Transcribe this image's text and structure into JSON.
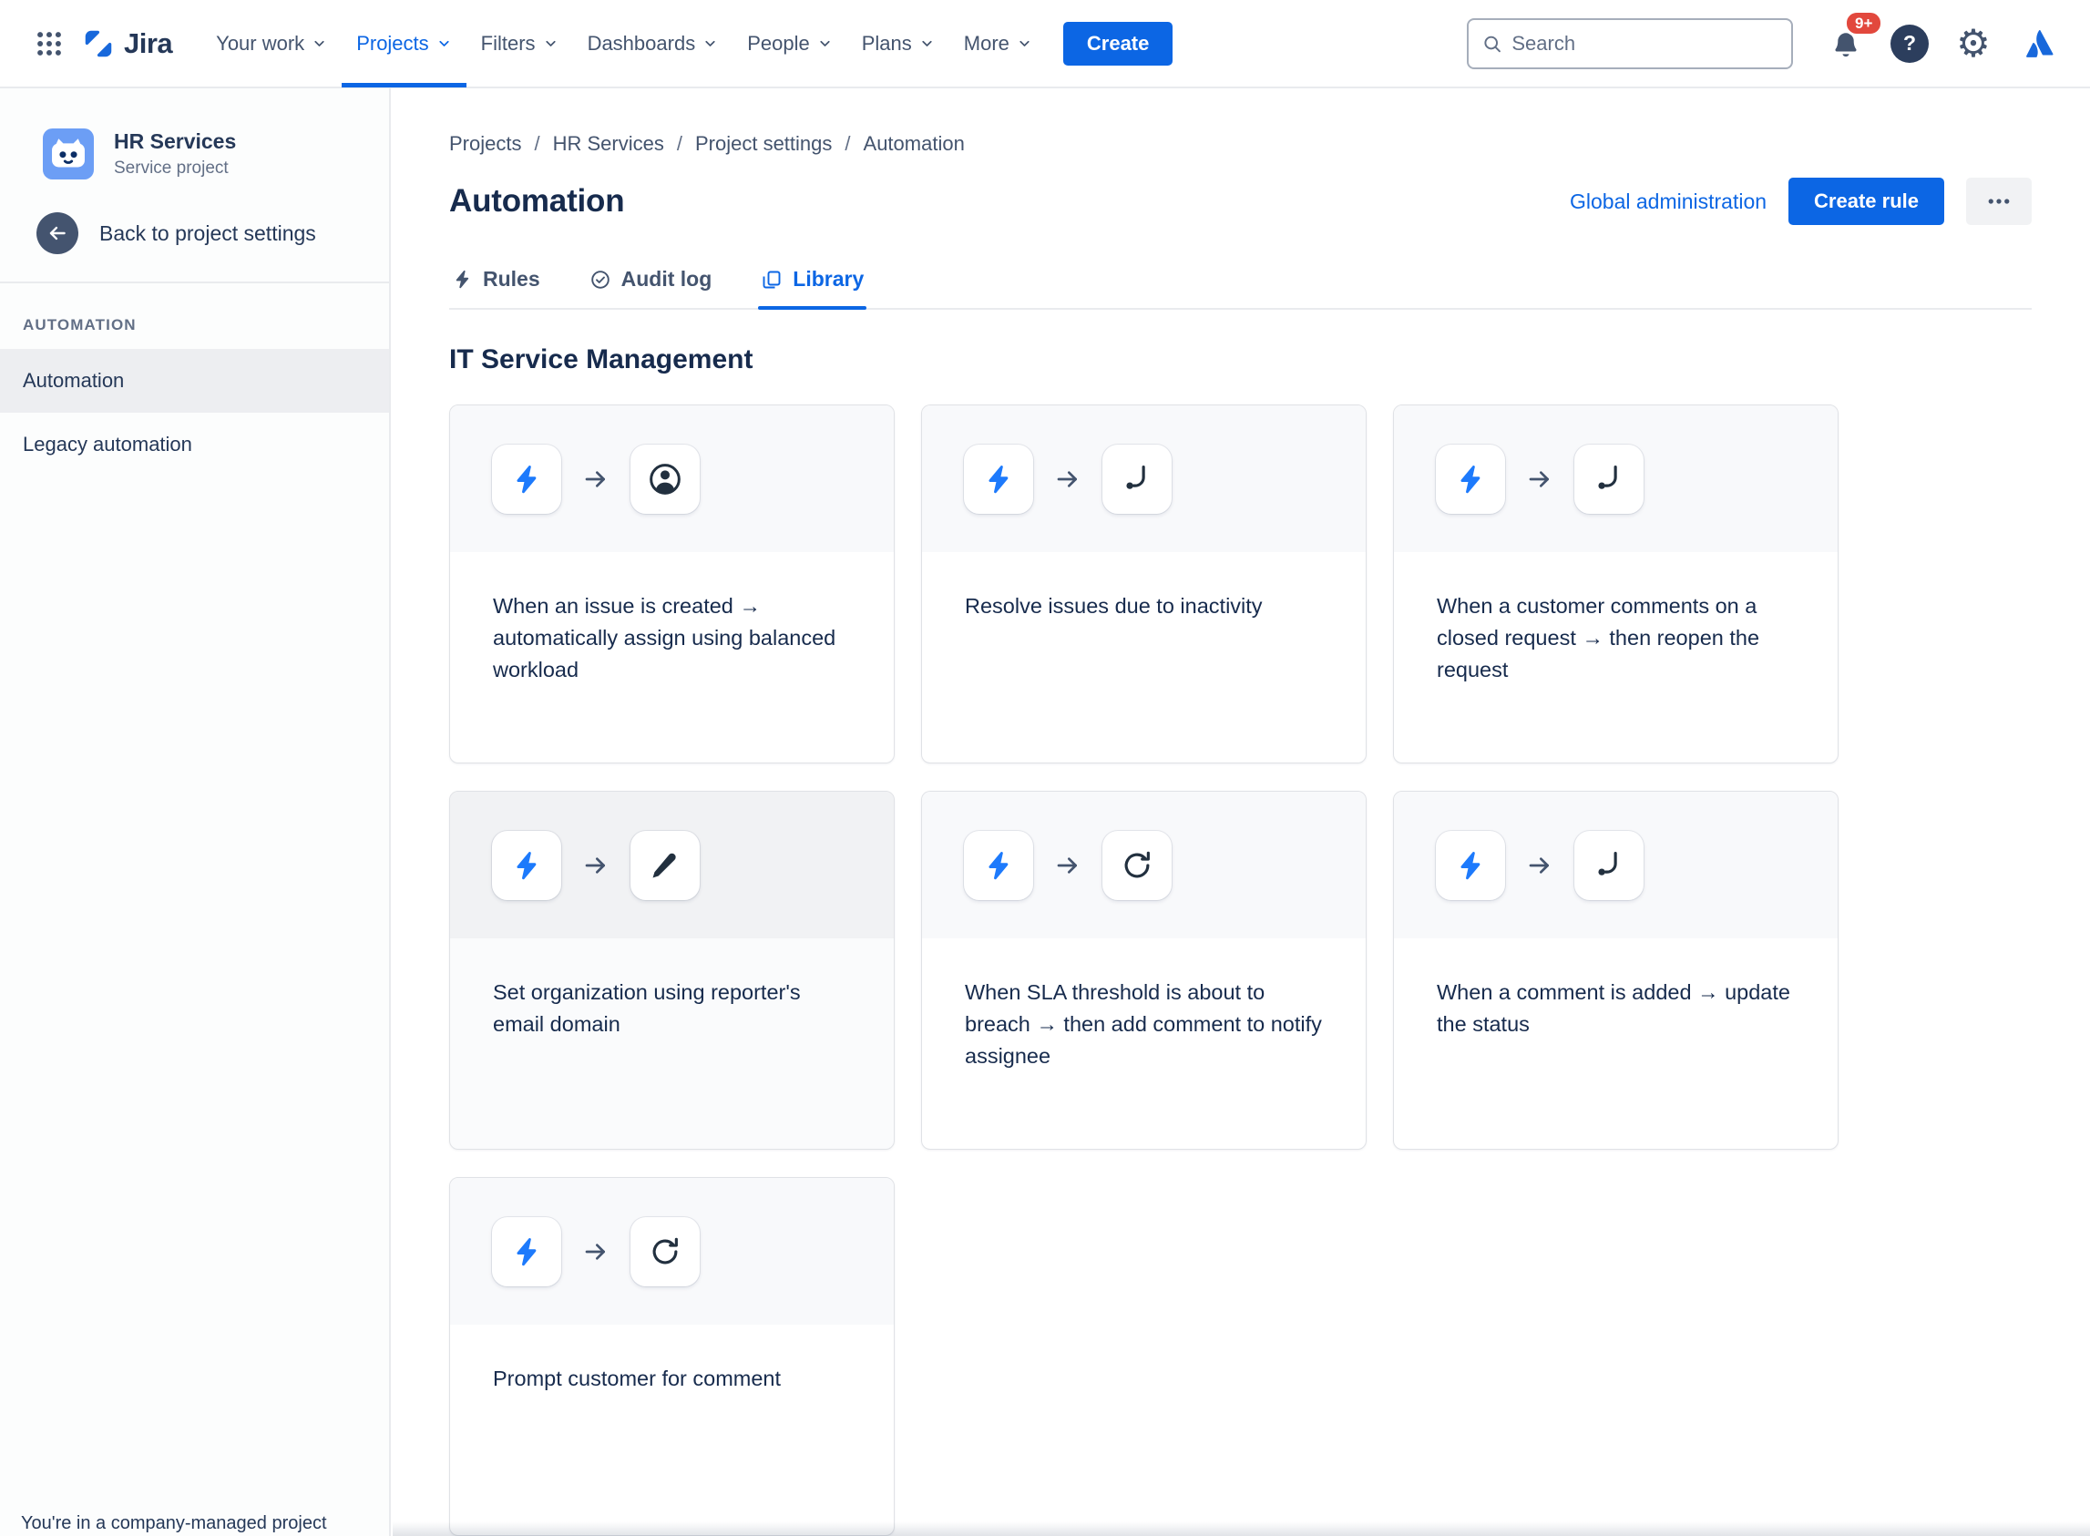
{
  "nav": {
    "app_name": "Jira",
    "items": [
      {
        "label": "Your work"
      },
      {
        "label": "Projects",
        "active": true
      },
      {
        "label": "Filters"
      },
      {
        "label": "Dashboards"
      },
      {
        "label": "People"
      },
      {
        "label": "Plans"
      },
      {
        "label": "More"
      }
    ],
    "create_label": "Create",
    "search_placeholder": "Search",
    "notifications_badge": "9+"
  },
  "icons": {
    "gear": "⚙",
    "help": "?"
  },
  "sidebar": {
    "project_name": "HR Services",
    "project_type": "Service project",
    "back_label": "Back to project settings",
    "section_title": "AUTOMATION",
    "items": [
      {
        "label": "Automation",
        "active": true
      },
      {
        "label": "Legacy automation"
      }
    ],
    "footer_note": "You're in a company-managed project"
  },
  "page": {
    "breadcrumb": [
      "Projects",
      "HR Services",
      "Project settings",
      "Automation"
    ],
    "breadcrumb_separator": "/",
    "title": "Automation",
    "global_admin_label": "Global administration",
    "create_rule_label": "Create rule",
    "tabs": [
      {
        "label": "Rules",
        "icon": "lightning-icon"
      },
      {
        "label": "Audit log",
        "icon": "check-circle-icon"
      },
      {
        "label": "Library",
        "icon": "library-icon",
        "active": true
      }
    ],
    "section_heading": "IT Service Management",
    "cards": [
      {
        "icon": "assignee-icon",
        "title": "When an issue is created → automatically assign using balanced workload"
      },
      {
        "icon": "branch-icon",
        "title": "Resolve issues due to inactivity"
      },
      {
        "icon": "branch-icon",
        "title": "When a customer comments on a closed request → then reopen the request"
      },
      {
        "icon": "edit-icon",
        "title": "Set organization using reporter's email domain",
        "state": "hover"
      },
      {
        "icon": "refresh-icon",
        "title": "When SLA threshold is about to breach → then add comment to notify assignee"
      },
      {
        "icon": "branch-icon",
        "title": "When a comment is added → update the status"
      },
      {
        "icon": "refresh-icon",
        "title": "Prompt customer for comment"
      }
    ]
  },
  "colors": {
    "brand_blue": "#0C66E4",
    "bolt_blue": "#1D7AFC",
    "badge_red": "#E2483D",
    "text_dark": "#172B4D",
    "text_subtle": "#44546E"
  }
}
